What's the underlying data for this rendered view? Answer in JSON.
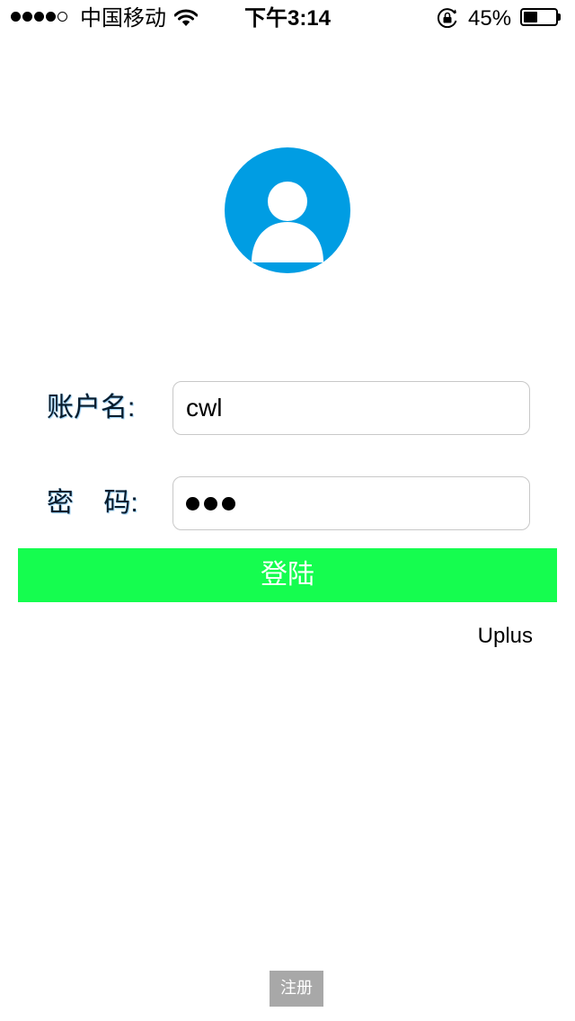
{
  "status_bar": {
    "signal_bars_filled": 4,
    "signal_bars_total": 5,
    "carrier": "中国移动",
    "time": "下午3:14",
    "battery_percent": "45%",
    "battery_level": 0.45,
    "icons": [
      "wifi-icon",
      "orientation-lock-icon",
      "battery-icon"
    ]
  },
  "avatar": {
    "icon": "user-avatar-icon",
    "color": "#009de3"
  },
  "login_form": {
    "username_label": "账户名:",
    "username_value": "cwl",
    "password_label": "密    码:",
    "password_masked_length": 3,
    "login_button_label": "登陆",
    "login_button_color": "#15fd4f"
  },
  "brand_text": "Uplus",
  "register_button_label": "注册"
}
